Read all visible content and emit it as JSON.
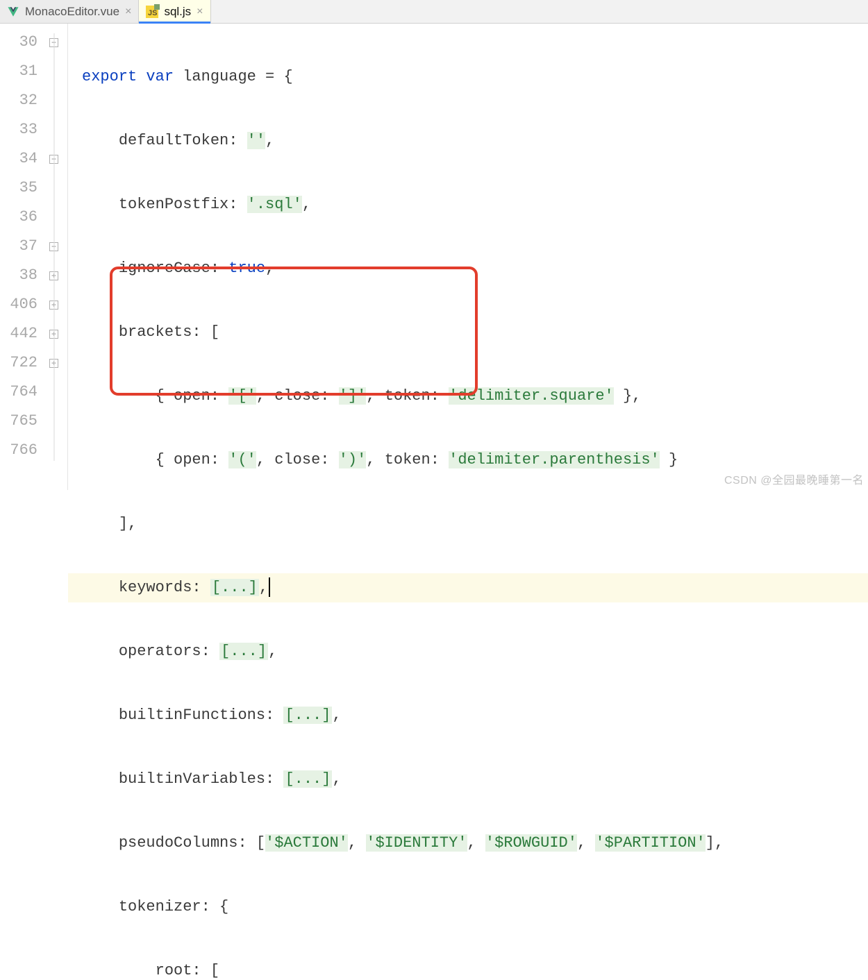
{
  "tabs": [
    {
      "label": "MonacoEditor.vue",
      "icon": "vue-icon",
      "active": false
    },
    {
      "label": "sql.js",
      "icon": "js-icon",
      "active": true
    }
  ],
  "gutter": [
    "30",
    "31",
    "32",
    "33",
    "34",
    "35",
    "36",
    "37",
    "38",
    "406",
    "442",
    "722",
    "764",
    "765",
    "766"
  ],
  "fold_marks": {
    "0": "minus",
    "4": "minus",
    "7": "minus-open",
    "8": "plus",
    "9": "plus",
    "10": "plus",
    "11": "plus"
  },
  "code": {
    "l30": {
      "kw1": "export",
      "kw2": "var",
      "id": "language",
      "eq": " = {"
    },
    "l31": {
      "key": "defaultToken: ",
      "val": "''",
      "tail": ","
    },
    "l32": {
      "key": "tokenPostfix: ",
      "val": "'.sql'",
      "tail": ","
    },
    "l33": {
      "key": "ignoreCase: ",
      "val": "true",
      "tail": ","
    },
    "l34": {
      "key": "brackets: [",
      "tail": ""
    },
    "l35": {
      "pre": "{ open: ",
      "v1": "'['",
      "mid": ", close: ",
      "v2": "']'",
      "mid2": ", token: ",
      "v3": "'delimiter.square'",
      "post": " },"
    },
    "l36": {
      "pre": "{ open: ",
      "v1": "'('",
      "mid": ", close: ",
      "v2": "')'",
      "mid2": ", token: ",
      "v3": "'delimiter.parenthesis'",
      "post": " }"
    },
    "l37": {
      "text": "],"
    },
    "l38": {
      "key": "keywords: ",
      "fold": "[...]",
      "tail": ","
    },
    "l406": {
      "key": "operators: ",
      "fold": "[...]",
      "tail": ","
    },
    "l442": {
      "key": "builtinFunctions: ",
      "fold": "[...]",
      "tail": ","
    },
    "l722": {
      "key": "builtinVariables: ",
      "fold": "[...]",
      "tail": ","
    },
    "l764": {
      "key": "pseudoColumns: [",
      "v1": "'$ACTION'",
      "c": ", ",
      "v2": "'$IDENTITY'",
      "v3": "'$ROWGUID'",
      "v4": "'$PARTITION'",
      "post": "],"
    },
    "l765": {
      "key": "tokenizer: {"
    },
    "l766": {
      "key": "root: ["
    }
  },
  "watermark": "CSDN @全园最晚睡第一名"
}
